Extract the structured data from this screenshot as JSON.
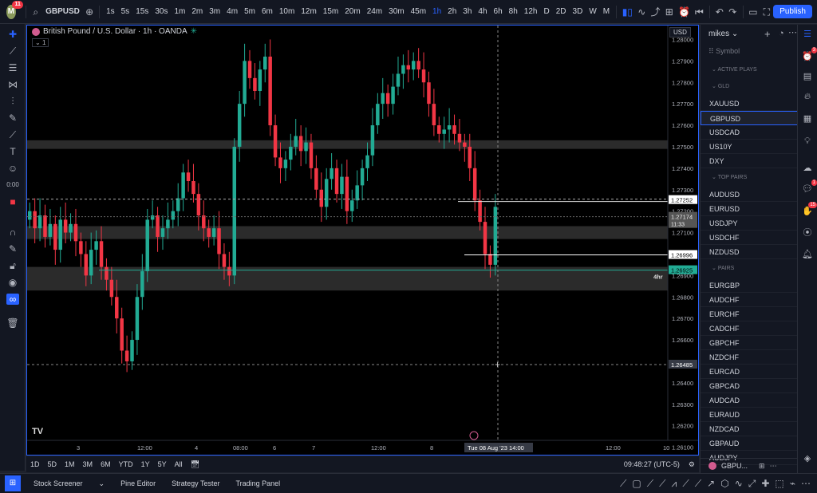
{
  "app": {
    "avatar_letter": "M",
    "avatar_badge": "11",
    "publish_label": "Publish"
  },
  "toolbar": {
    "symbol": "GBPUSD",
    "intervals": [
      "1s",
      "5s",
      "15s",
      "30s",
      "1m",
      "2m",
      "3m",
      "4m",
      "5m",
      "6m",
      "10m",
      "12m",
      "15m",
      "20m",
      "24m",
      "30m",
      "45m",
      "1h",
      "2h",
      "3h",
      "4h",
      "6h",
      "8h",
      "12h",
      "D",
      "2D",
      "3D",
      "W",
      "M"
    ],
    "active_interval": "1h"
  },
  "chart": {
    "legend_title": "British Pound / U.S. Dollar · 1h · OANDA",
    "legend_box": "1",
    "currency_tag": "USD",
    "watermark": "TV",
    "price_labels": [
      "1.28000",
      "1.27900",
      "1.27800",
      "1.27700",
      "1.27600",
      "1.27500",
      "1.27400",
      "1.27300",
      "1.27200",
      "1.27100",
      "1.27000",
      "1.26900",
      "1.26800",
      "1.26700",
      "1.26600",
      "1.26500",
      "1.26400",
      "1.26300",
      "1.26200",
      "1.26100"
    ],
    "marker_labels": {
      "white_line": "1.27252",
      "grey_price": "1.27174",
      "grey_countdown": "11:33",
      "box_line": "1.26996",
      "green_price": "1.26925",
      "cursor_price": "1.26485",
      "zone_tag": "4hr"
    },
    "time_labels": [
      "3",
      "12:00",
      "4",
      "08:00",
      "6",
      "7",
      "12:00",
      "8",
      "12:00",
      "10"
    ],
    "cursor_time": "Tue 08 Aug '23   14:00",
    "colors": {
      "up": "#22ab94",
      "down": "#f23645",
      "zone": "#3a3a3a",
      "accent": "#2962ff"
    }
  },
  "chart_data": {
    "type": "candlestick",
    "title": "British Pound / U.S. Dollar · 1h · OANDA",
    "xlabel": "",
    "ylabel": "",
    "ylim": [
      1.2605,
      1.2805
    ],
    "y_ticks": [
      1.28,
      1.279,
      1.278,
      1.277,
      1.276,
      1.275,
      1.274,
      1.273,
      1.272,
      1.271,
      1.27,
      1.269,
      1.268,
      1.267,
      1.266,
      1.265,
      1.264,
      1.263,
      1.262,
      1.261
    ],
    "closes": [
      1.272,
      1.2712,
      1.2718,
      1.2708,
      1.2714,
      1.2702,
      1.2716,
      1.271,
      1.2714,
      1.2706,
      1.27,
      1.269,
      1.2702,
      1.2706,
      1.2694,
      1.2688,
      1.268,
      1.267,
      1.2655,
      1.265,
      1.266,
      1.268,
      1.2692,
      1.2716,
      1.2718,
      1.2708,
      1.2712,
      1.2716,
      1.272,
      1.2726,
      1.2738,
      1.2734,
      1.2728,
      1.2718,
      1.2712,
      1.2708,
      1.2712,
      1.27,
      1.2694,
      1.269,
      1.275,
      1.277,
      1.279,
      1.2782,
      1.2776,
      1.2786,
      1.2792,
      1.276,
      1.2745,
      1.274,
      1.2744,
      1.275,
      1.2755,
      1.2748,
      1.2752,
      1.274,
      1.273,
      1.2722,
      1.2735,
      1.274,
      1.2728,
      1.2736,
      1.272,
      1.2725,
      1.2732,
      1.274,
      1.2746,
      1.276,
      1.277,
      1.2775,
      1.277,
      1.2778,
      1.2784,
      1.2788,
      1.2786,
      1.279,
      1.2786,
      1.278,
      1.277,
      1.276,
      1.2756,
      1.2758,
      1.276,
      1.2756,
      1.2752,
      1.275,
      1.274,
      1.2725,
      1.2715,
      1.27,
      1.2695,
      1.2722
    ],
    "open_first": 1.2716,
    "zones": [
      {
        "from": 1.2749,
        "to": 1.2753,
        "color": "#3a3a3a"
      },
      {
        "from": 1.2707,
        "to": 1.2713,
        "color": "#3a3a3a"
      },
      {
        "from": 1.2683,
        "to": 1.2694,
        "color": "#3a3a3a"
      }
    ],
    "lines": {
      "white": 1.27252,
      "green": 1.26925,
      "box_top": 1.26996,
      "cursor": 1.26485
    },
    "cursor_index": 91
  },
  "timeframes": {
    "items": [
      "1D",
      "5D",
      "1M",
      "3M",
      "6M",
      "YTD",
      "1Y",
      "5Y",
      "All"
    ],
    "clock": "09:48:27 (UTC-5)"
  },
  "bottom": {
    "items": [
      "Stock Screener",
      "Pine Editor",
      "Strategy Tester",
      "Trading Panel"
    ]
  },
  "watchlist": {
    "name": "mikes",
    "column": "Symbol",
    "sections": [
      {
        "title": "ACTIVE PLAYS",
        "items": []
      },
      {
        "title": "GLD",
        "items": [
          "XAUUSD",
          "GBPUSD",
          "USDCAD",
          "US10Y",
          "DXY"
        ]
      },
      {
        "title": "TOP PAIRS",
        "items": [
          "AUDUSD",
          "EURUSD",
          "USDJPY",
          "USDCHF",
          "NZDUSD"
        ]
      },
      {
        "title": "PAIRS",
        "items": [
          "EURGBP",
          "AUDCHF",
          "EURCHF",
          "CADCHF",
          "GBPCHF",
          "NZDCHF",
          "EURCAD",
          "GBPCAD",
          "AUDCAD",
          "EURAUD",
          "NZDCAD",
          "GBPAUD",
          "AUDJPY"
        ]
      }
    ],
    "selected": "GBPUSD",
    "footer_symbol": "GBPU..."
  },
  "rightbar": {
    "badges": [
      "3",
      "1",
      "15"
    ]
  }
}
